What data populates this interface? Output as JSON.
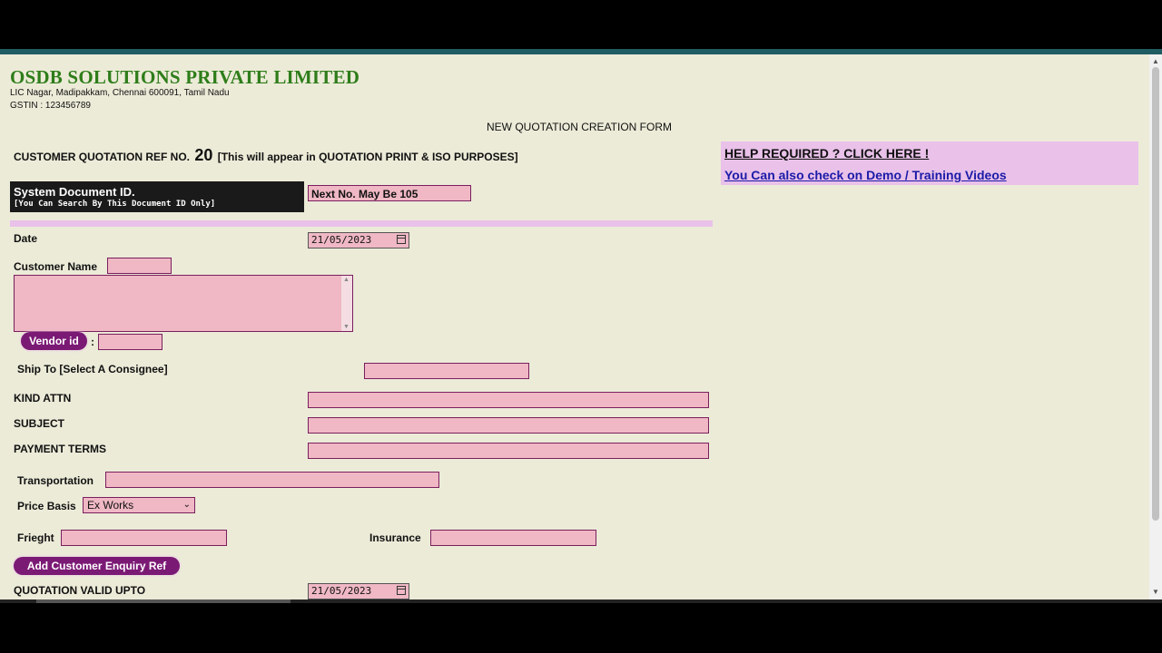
{
  "company": {
    "name": "OSDB SOLUTIONS PRIVATE LIMITED",
    "address": "LIC Nagar, Madipakkam, Chennai 600091, Tamil Nadu",
    "gstin": "GSTIN : 123456789"
  },
  "form_title": "NEW QUOTATION CREATION FORM",
  "quotation_ref": {
    "label": "CUSTOMER QUOTATION REF NO.",
    "number": "20",
    "note": "[This will appear in QUOTATION PRINT & ISO PURPOSES]"
  },
  "help": {
    "link_text": "HELP REQUIRED ? CLICK HERE !",
    "demo_text": "You Can also check on Demo / Training Videos"
  },
  "system_doc": {
    "title": "System Document ID.",
    "subtitle": "[You Can Search By This Document ID Only]",
    "next_no": "Next No. May Be 105"
  },
  "fields": {
    "date_label": "Date",
    "date_value": "21/05/2023",
    "customer_name_label": "Customer Name",
    "vendor_id_button": "Vendor id",
    "vendor_colon": ":",
    "ship_to_label": "Ship To [Select A Consignee]",
    "kind_attn_label": "KIND ATTN",
    "subject_label": "SUBJECT",
    "payment_terms_label": "PAYMENT TERMS",
    "transportation_label": "Transportation",
    "price_basis_label": "Price Basis",
    "price_basis_value": "Ex Works",
    "freight_label": "Frieght",
    "insurance_label": "Insurance",
    "add_enquiry_button": "Add Customer Enquiry Ref",
    "valid_upto_label": "QUOTATION VALID UPTO",
    "valid_upto_value": "21/05/2023"
  },
  "colors": {
    "page_bg": "#ecebd8",
    "field_bg": "#efb8c4",
    "field_border": "#7a1f5e",
    "company_green": "#2e7d1a",
    "help_bg": "#e9c1e9",
    "button_purple": "#7b1a75",
    "link_blue": "#1b1ba8"
  },
  "icons": {
    "date_picker": "calendar-icon",
    "select": "chevron-down-icon"
  }
}
